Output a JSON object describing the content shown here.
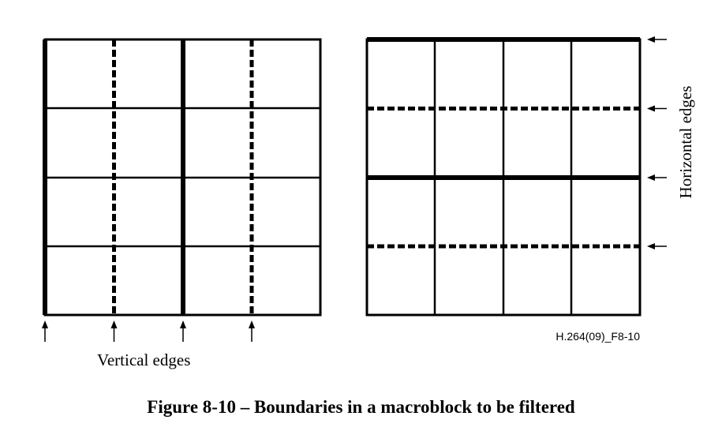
{
  "diagram": {
    "vertical_label": "Vertical edges",
    "horizontal_label": "Horizontal edges",
    "figure_id": "H.264(09)_F8-10",
    "caption": "Figure 8-10 – Boundaries in a macroblock to be filtered"
  }
}
